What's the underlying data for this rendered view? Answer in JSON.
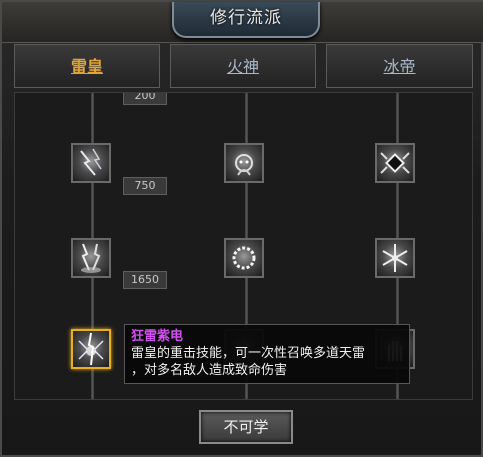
{
  "window": {
    "title": "修行流派"
  },
  "tabs": [
    {
      "label": "雷皇",
      "active": true
    },
    {
      "label": "火神",
      "active": false
    },
    {
      "label": "冰帝",
      "active": false
    }
  ],
  "requirements": [
    "200",
    "750",
    "1650"
  ],
  "skills": [
    {
      "icon": "lightning-storm-icon"
    },
    {
      "icon": "fire-spirit-icon"
    },
    {
      "icon": "ice-shield-icon"
    },
    {
      "icon": "thunder-strike-icon"
    },
    {
      "icon": "fire-ring-icon"
    },
    {
      "icon": "snowflake-icon"
    },
    {
      "icon": "purple-thunder-icon",
      "selected": true
    }
  ],
  "tooltip": {
    "name": "狂雷紫电",
    "line1": "雷皇的重击技能，可一次性召唤多道天雷",
    "line2": "，对多名敌人造成致命伤害"
  },
  "action_button": {
    "label": "不可学"
  },
  "colors": {
    "active_tab": "#e0a53a",
    "inactive_tab": "#a9b8c8",
    "skill_name": "#d050f0",
    "selected_border": "#e8b020"
  }
}
